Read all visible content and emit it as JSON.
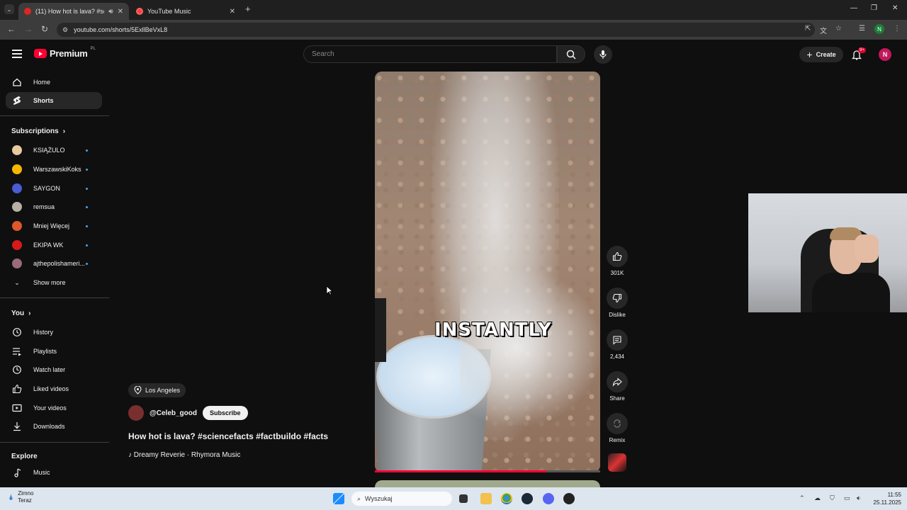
{
  "browser": {
    "tabs": [
      {
        "label": "(11) How hot is lava? #scier",
        "active": true
      },
      {
        "label": "YouTube Music",
        "active": false
      }
    ],
    "url": "youtube.com/shorts/5ExllBeVxL8",
    "profile_initial": "N"
  },
  "header": {
    "brand": "Premium",
    "region": "PL",
    "search_placeholder": "Search",
    "create_label": "Create",
    "notif_badge": "9+",
    "avatar_initial": "N"
  },
  "sidebar": {
    "main": [
      {
        "label": "Home",
        "icon": "home-icon"
      },
      {
        "label": "Shorts",
        "icon": "shorts-icon",
        "active": true
      }
    ],
    "subscriptions_title": "Subscriptions",
    "subscriptions": [
      {
        "label": "KSIĄŻULO",
        "color": "#e8c9a0"
      },
      {
        "label": "WarszawskiKoks",
        "color": "#f5b700"
      },
      {
        "label": "SAYGON",
        "color": "#4a5bd4"
      },
      {
        "label": "remsua",
        "color": "#b8b0a4"
      },
      {
        "label": "Mniej Więcej",
        "color": "#e0572b"
      },
      {
        "label": "EKIPA WK",
        "color": "#d51a1a"
      },
      {
        "label": "ajthepolishameri...",
        "color": "#9a6b7a"
      }
    ],
    "show_more": "Show more",
    "you_title": "You",
    "you_items": [
      {
        "label": "History",
        "icon": "history-icon"
      },
      {
        "label": "Playlists",
        "icon": "playlists-icon"
      },
      {
        "label": "Watch later",
        "icon": "watch-later-icon"
      },
      {
        "label": "Liked videos",
        "icon": "thumbs-up-icon"
      },
      {
        "label": "Your videos",
        "icon": "your-videos-icon"
      },
      {
        "label": "Downloads",
        "icon": "download-icon"
      }
    ],
    "explore_title": "Explore",
    "explore_items": [
      {
        "label": "Music",
        "icon": "music-icon"
      }
    ]
  },
  "video": {
    "caption": "INSTANTLY",
    "progress": 0.76,
    "location": "Los Angeles",
    "channel": "@Celeb_good",
    "subscribe_label": "Subscribe",
    "title": "How hot is lava? #sciencefacts #factbuildo #facts",
    "music": "Dreamy Reverie · Rhymora Music"
  },
  "actions": {
    "likes": "301K",
    "dislike": "Dislike",
    "comments": "2,434",
    "share": "Share",
    "remix": "Remix"
  },
  "taskbar": {
    "weather_line1": "Zimno",
    "weather_line2": "Teraz",
    "search_placeholder": "Wyszukaj",
    "time": "11:55",
    "date": "25.11.2025"
  }
}
